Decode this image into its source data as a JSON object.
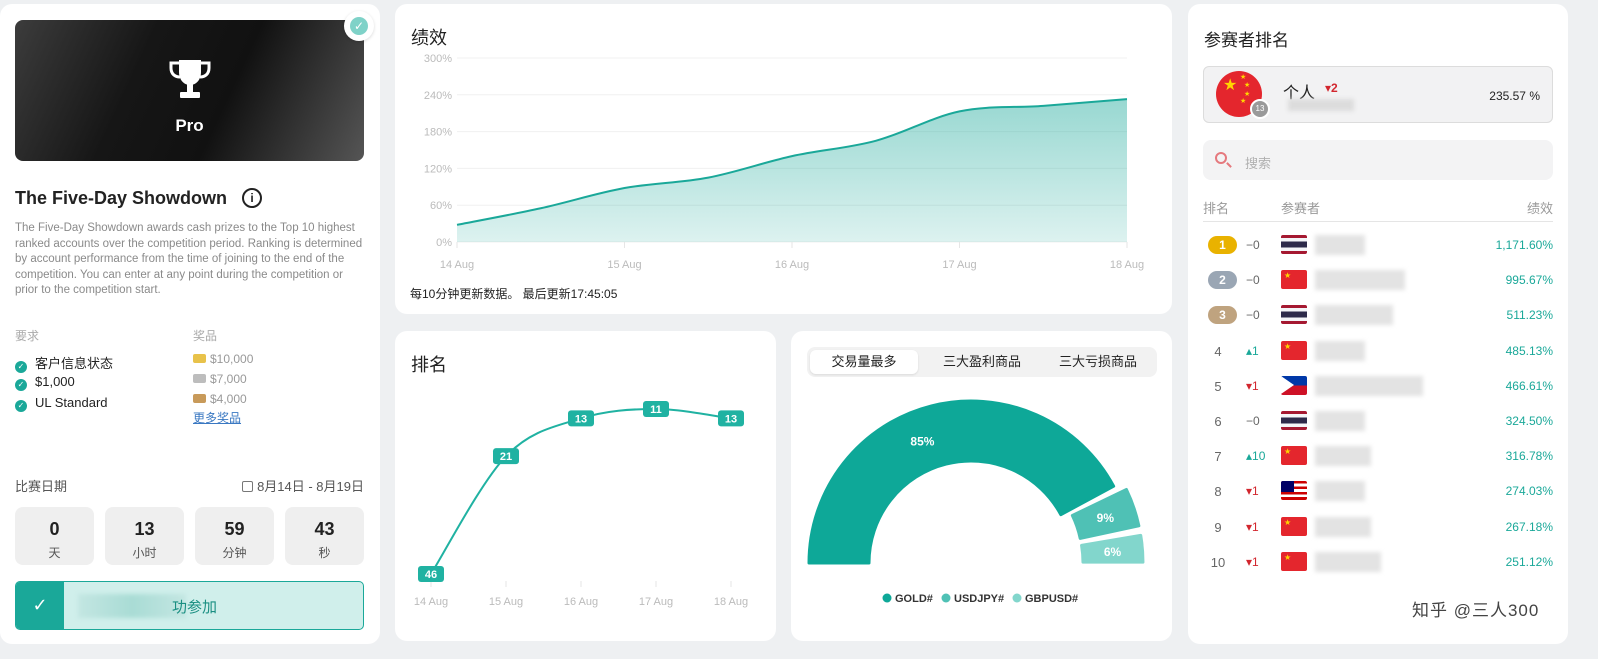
{
  "competition": {
    "badge": "Pro",
    "title": "The Five-Day Showdown",
    "description": "The Five-Day Showdown awards cash prizes to the Top 10 highest ranked accounts over the competition period. Ranking is determined by account performance from the time of joining to the end of the competition. You can enter at any point during the competition or prior to the competition start.",
    "requirements_label": "要求",
    "requirements": [
      "客户信息状态",
      "$1,000",
      "UL Standard"
    ],
    "prizes_label": "奖品",
    "prizes": [
      "$10,000",
      "$7,000",
      "$4,000"
    ],
    "more_prizes": "更多奖品",
    "date_label": "比赛日期",
    "date_range": "8月14日 - 8月19日",
    "countdown": [
      {
        "value": "0",
        "unit": "天"
      },
      {
        "value": "13",
        "unit": "小时"
      },
      {
        "value": "59",
        "unit": "分钟"
      },
      {
        "value": "43",
        "unit": "秒"
      }
    ],
    "join_status": "功参加"
  },
  "performance": {
    "title": "绩效",
    "update_note": "每10分钟更新数据。 最后更新17:45:05"
  },
  "ranking": {
    "title": "排名"
  },
  "products": {
    "tabs": [
      "交易量最多",
      "三大盈利商品",
      "三大亏损商品"
    ],
    "active_tab": 0
  },
  "chart_data": [
    {
      "type": "area",
      "title": "绩效",
      "x": [
        "14 Aug",
        "15 Aug",
        "16 Aug",
        "17 Aug",
        "18 Aug"
      ],
      "y_ticks": [
        "300%",
        "240%",
        "180%",
        "120%",
        "60%",
        "0%"
      ],
      "ylim": [
        0,
        300
      ],
      "series": [
        {
          "points": [
            [
              0,
              28
            ],
            [
              0.5,
              55
            ],
            [
              1,
              88
            ],
            [
              1.5,
              105
            ],
            [
              2,
              140
            ],
            [
              2.5,
              165
            ],
            [
              3,
              213
            ],
            [
              3.5,
              222
            ],
            [
              4,
              233
            ]
          ]
        }
      ],
      "color": "#1aa899"
    },
    {
      "type": "line",
      "title": "排名",
      "categories": [
        "14 Aug",
        "15 Aug",
        "16 Aug",
        "17 Aug",
        "18 Aug"
      ],
      "values": [
        46,
        21,
        13,
        11,
        13
      ],
      "y_inverted": true,
      "color": "#20b2a2"
    },
    {
      "type": "pie",
      "variant": "semicircle",
      "labels": [
        "GOLD#",
        "USDJPY#",
        "GBPUSD#"
      ],
      "values": [
        85,
        9,
        6
      ],
      "value_labels": [
        "85%",
        "9%",
        "6%"
      ],
      "colors": [
        "#0ea898",
        "#4fc1b5",
        "#82d6cc"
      ]
    }
  ],
  "leaderboard": {
    "title": "参赛者排名",
    "me": {
      "name": "个人",
      "delta": "2",
      "level": "13",
      "performance": "235.57 %"
    },
    "search_placeholder": "搜索",
    "columns": [
      "排名",
      "参赛者",
      "绩效"
    ],
    "rows": [
      {
        "rank": "1",
        "change": "−0",
        "dir": "same",
        "flag": "th",
        "perf": "1,171.60%",
        "medal": "#e9b200"
      },
      {
        "rank": "2",
        "change": "−0",
        "dir": "same",
        "flag": "cn",
        "perf": "995.67%",
        "medal": "#9aa6b4"
      },
      {
        "rank": "3",
        "change": "−0",
        "dir": "same",
        "flag": "th",
        "perf": "511.23%",
        "medal": "#bfa37f"
      },
      {
        "rank": "4",
        "change": "1",
        "dir": "up",
        "flag": "cn",
        "perf": "485.13%"
      },
      {
        "rank": "5",
        "change": "1",
        "dir": "down",
        "flag": "ph",
        "perf": "466.61%"
      },
      {
        "rank": "6",
        "change": "−0",
        "dir": "same",
        "flag": "th",
        "perf": "324.50%"
      },
      {
        "rank": "7",
        "change": "10",
        "dir": "up",
        "flag": "cn",
        "perf": "316.78%"
      },
      {
        "rank": "8",
        "change": "1",
        "dir": "down",
        "flag": "my",
        "perf": "274.03%"
      },
      {
        "rank": "9",
        "change": "1",
        "dir": "down",
        "flag": "cn",
        "perf": "267.18%"
      },
      {
        "rank": "10",
        "change": "1",
        "dir": "down",
        "flag": "cn",
        "perf": "251.12%"
      }
    ]
  },
  "watermark": "知乎 @三人300"
}
